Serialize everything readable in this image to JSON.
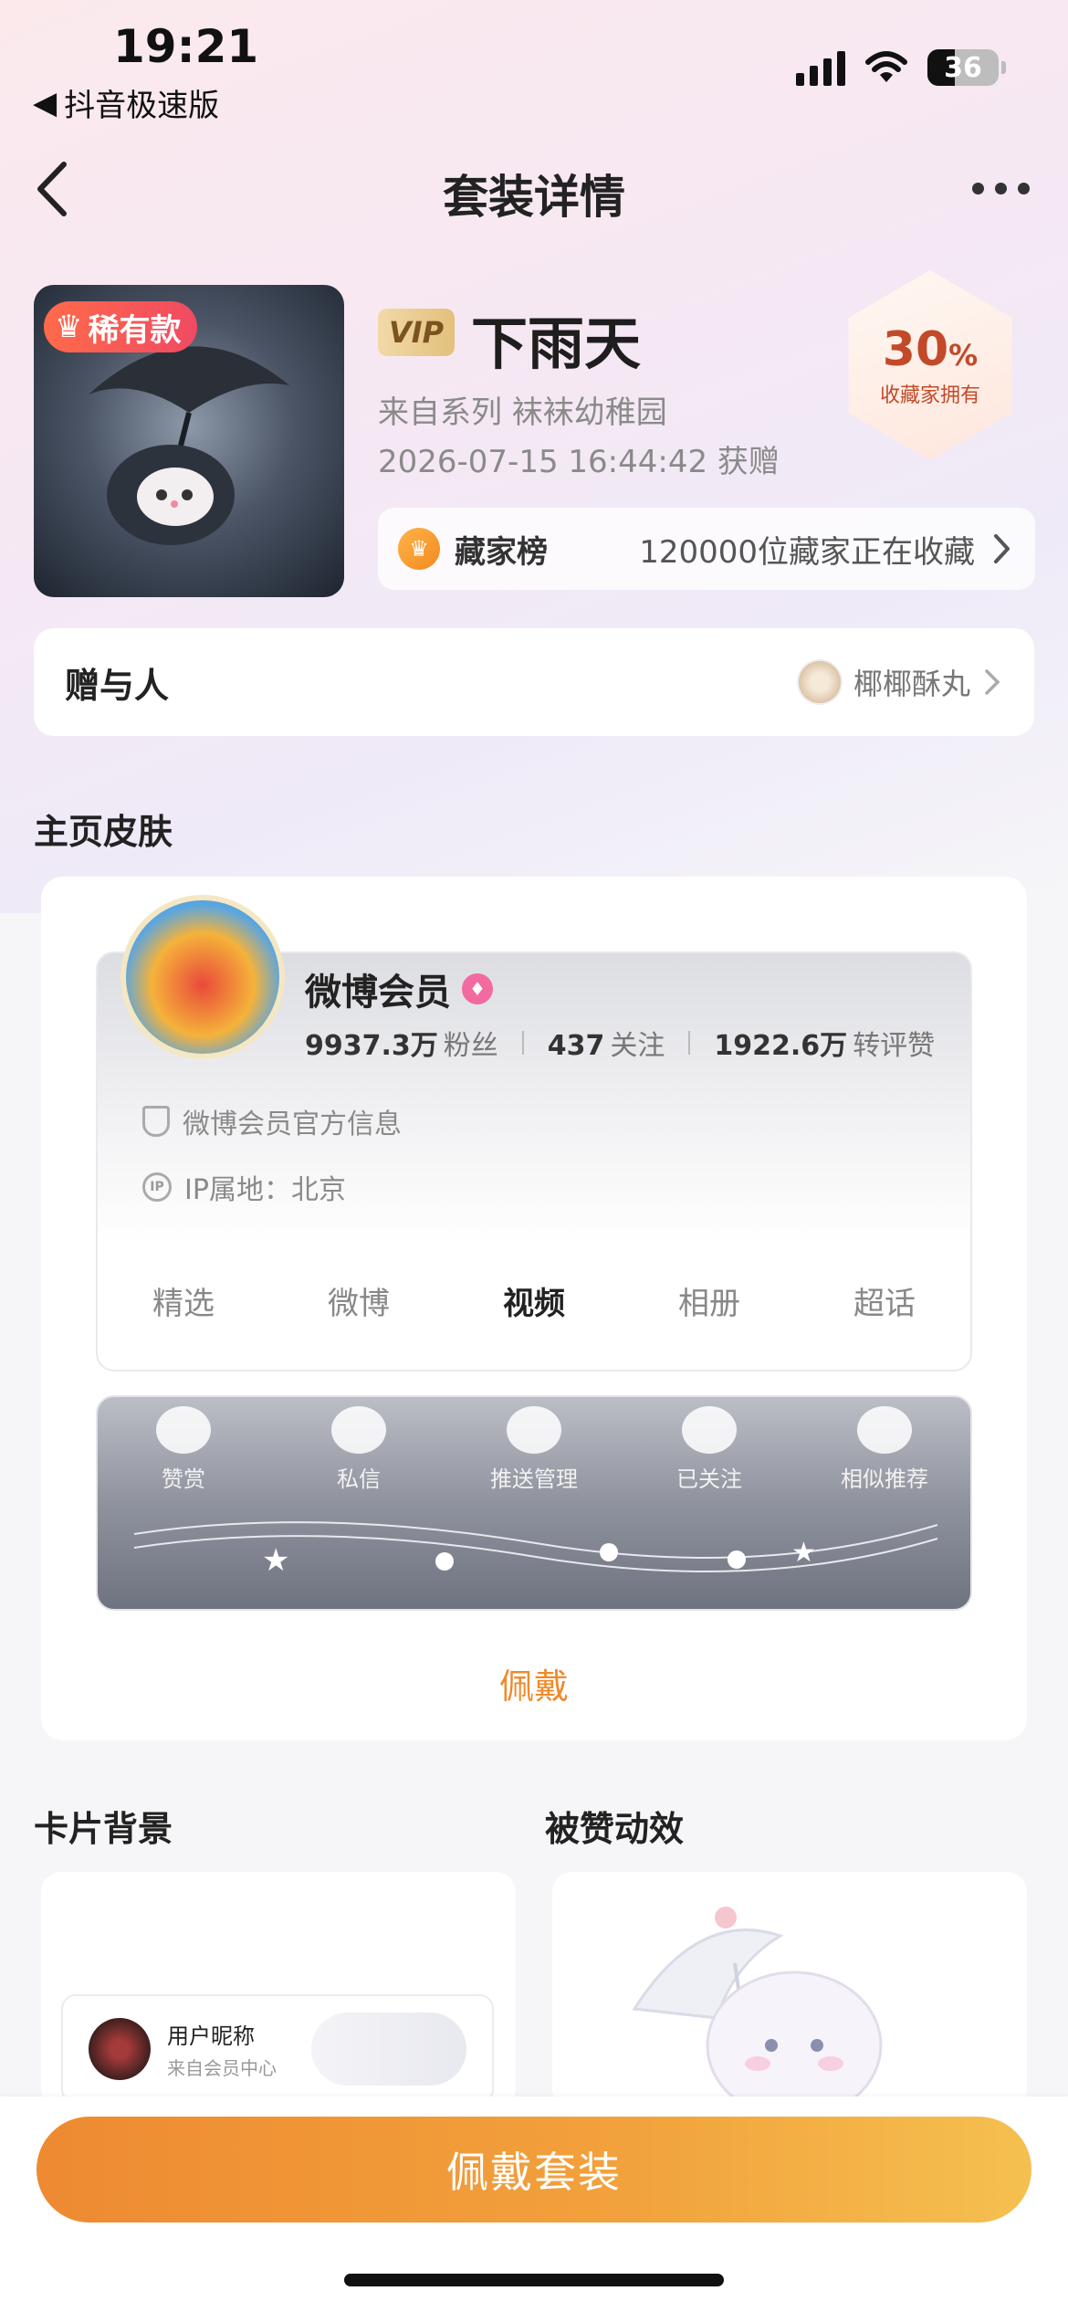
{
  "status": {
    "time": "19:21",
    "back_app": "抖音极速版",
    "battery": "36"
  },
  "nav": {
    "title": "套装详情"
  },
  "hero": {
    "rare_badge": "稀有款",
    "vip_tag": "VIP",
    "name": "下雨天",
    "series": "来自系列 袜袜幼稚园",
    "gift_time": "2026-07-15 16:44:42 获赠",
    "own_pct": "30",
    "own_pct_unit": "%",
    "own_label": "收藏家拥有",
    "rank_label": "藏家榜",
    "rank_text": "120000位藏家正在收藏"
  },
  "giver": {
    "label": "赠与人",
    "name": "椰椰酥丸"
  },
  "skin": {
    "heading": "主页皮肤",
    "user_name": "微博会员",
    "fans_num": "9937.3万",
    "fans_unit": "粉丝",
    "follow_num": "437",
    "follow_unit": "关注",
    "likes_num": "1922.6万",
    "likes_unit": "转评赞",
    "info1": "微博会员官方信息",
    "info2": "IP属地：北京",
    "tabs": [
      "精选",
      "微博",
      "视频",
      "相册",
      "超话"
    ],
    "strip": [
      "赞赏",
      "私信",
      "推送管理",
      "已关注",
      "相似推荐"
    ],
    "wear_label": "佩戴"
  },
  "cards": {
    "bg_heading": "卡片背景",
    "like_heading": "被赞动效",
    "mini_name": "用户昵称",
    "mini_sub": "来自会员中心"
  },
  "bottom": {
    "wear_suit": "佩戴套装"
  },
  "colors": {
    "accent": "#f08a2a",
    "rare": "#f04a62",
    "own": "#c24a2a"
  }
}
